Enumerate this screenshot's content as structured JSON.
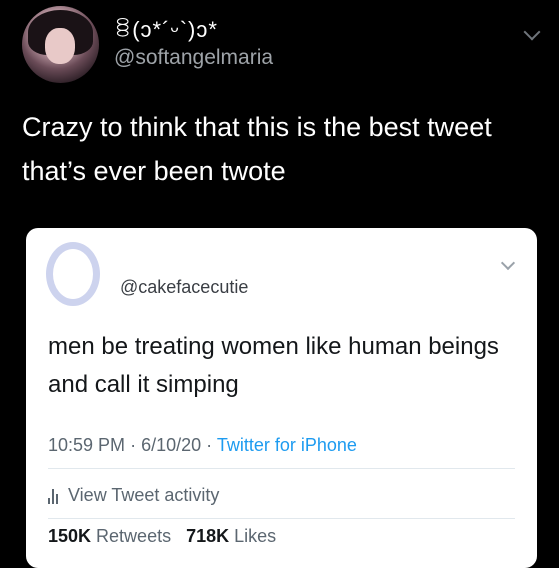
{
  "outer_tweet": {
    "display_name": "ꊞ(ↄ*´ᵕ`)ↄ*",
    "handle": "@softangelmaria",
    "text": "Crazy to think that this is the best tweet that’s ever been twote"
  },
  "quoted_tweet": {
    "handle": "@cakefacecutie",
    "text": "men be treating women like human beings and call it simping",
    "time": "10:59 PM",
    "date": "6/10/20",
    "separator": "·",
    "source": "Twitter for iPhone",
    "activity_label": "View Tweet activity",
    "retweets_count": "150K",
    "retweets_label": "Retweets",
    "likes_count": "718K",
    "likes_label": "Likes"
  },
  "colors": {
    "background": "#000000",
    "card": "#ffffff",
    "link": "#1d9bf0",
    "muted": "#9ea3a8"
  },
  "icons": [
    "chevron-down-icon",
    "bar-chart-icon"
  ]
}
